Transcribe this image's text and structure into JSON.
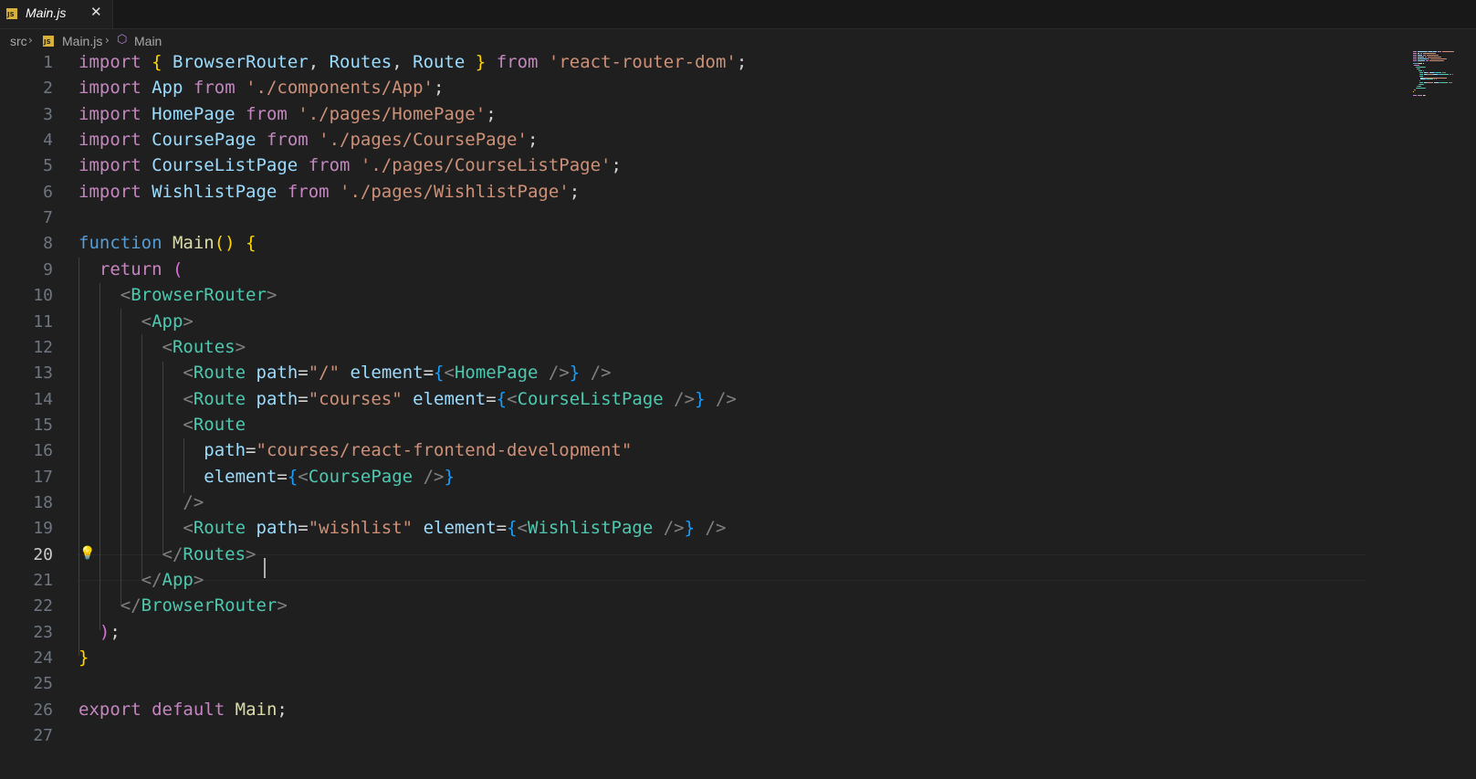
{
  "tab": {
    "filename": "Main.js",
    "badge": "JS",
    "close_glyph": "✕"
  },
  "breadcrumb": {
    "items": [
      "src",
      "Main.js",
      "Main"
    ],
    "separator": "›",
    "badge": "JS"
  },
  "editor": {
    "active_line": 20,
    "line_numbers": [
      "1",
      "2",
      "3",
      "4",
      "5",
      "6",
      "7",
      "8",
      "9",
      "10",
      "11",
      "12",
      "13",
      "14",
      "15",
      "16",
      "17",
      "18",
      "19",
      "20",
      "21",
      "22",
      "23",
      "24",
      "25",
      "26",
      "27"
    ],
    "lines": [
      [
        [
          "k",
          "import"
        ],
        [
          "p",
          " "
        ],
        [
          "b1",
          "{"
        ],
        [
          "p",
          " "
        ],
        [
          "v",
          "BrowserRouter"
        ],
        [
          "p",
          ", "
        ],
        [
          "v",
          "Routes"
        ],
        [
          "p",
          ", "
        ],
        [
          "v",
          "Route"
        ],
        [
          "p",
          " "
        ],
        [
          "b1",
          "}"
        ],
        [
          "p",
          " "
        ],
        [
          "k",
          "from"
        ],
        [
          "p",
          " "
        ],
        [
          "s",
          "'react-router-dom'"
        ],
        [
          "p",
          ";"
        ]
      ],
      [
        [
          "k",
          "import"
        ],
        [
          "p",
          " "
        ],
        [
          "v",
          "App"
        ],
        [
          "p",
          " "
        ],
        [
          "k",
          "from"
        ],
        [
          "p",
          " "
        ],
        [
          "s",
          "'./components/App'"
        ],
        [
          "p",
          ";"
        ]
      ],
      [
        [
          "k",
          "import"
        ],
        [
          "p",
          " "
        ],
        [
          "v",
          "HomePage"
        ],
        [
          "p",
          " "
        ],
        [
          "k",
          "from"
        ],
        [
          "p",
          " "
        ],
        [
          "s",
          "'./pages/HomePage'"
        ],
        [
          "p",
          ";"
        ]
      ],
      [
        [
          "k",
          "import"
        ],
        [
          "p",
          " "
        ],
        [
          "v",
          "CoursePage"
        ],
        [
          "p",
          " "
        ],
        [
          "k",
          "from"
        ],
        [
          "p",
          " "
        ],
        [
          "s",
          "'./pages/CoursePage'"
        ],
        [
          "p",
          ";"
        ]
      ],
      [
        [
          "k",
          "import"
        ],
        [
          "p",
          " "
        ],
        [
          "v",
          "CourseListPage"
        ],
        [
          "p",
          " "
        ],
        [
          "k",
          "from"
        ],
        [
          "p",
          " "
        ],
        [
          "s",
          "'./pages/CourseListPage'"
        ],
        [
          "p",
          ";"
        ]
      ],
      [
        [
          "k",
          "import"
        ],
        [
          "p",
          " "
        ],
        [
          "v",
          "WishlistPage"
        ],
        [
          "p",
          " "
        ],
        [
          "k",
          "from"
        ],
        [
          "p",
          " "
        ],
        [
          "s",
          "'./pages/WishlistPage'"
        ],
        [
          "p",
          ";"
        ]
      ],
      [],
      [
        [
          "kb",
          "function"
        ],
        [
          "p",
          " "
        ],
        [
          "f",
          "Main"
        ],
        [
          "b1",
          "()"
        ],
        [
          "p",
          " "
        ],
        [
          "b1",
          "{"
        ]
      ],
      [
        [
          "p",
          "  "
        ],
        [
          "k",
          "return"
        ],
        [
          "p",
          " "
        ],
        [
          "b2",
          "("
        ]
      ],
      [
        [
          "p",
          "    "
        ],
        [
          "g",
          "<"
        ],
        [
          "t",
          "BrowserRouter"
        ],
        [
          "g",
          ">"
        ]
      ],
      [
        [
          "p",
          "      "
        ],
        [
          "g",
          "<"
        ],
        [
          "t",
          "App"
        ],
        [
          "g",
          ">"
        ]
      ],
      [
        [
          "p",
          "        "
        ],
        [
          "g",
          "<"
        ],
        [
          "t",
          "Routes"
        ],
        [
          "g",
          ">"
        ]
      ],
      [
        [
          "p",
          "          "
        ],
        [
          "g",
          "<"
        ],
        [
          "t",
          "Route"
        ],
        [
          "p",
          " "
        ],
        [
          "v",
          "path"
        ],
        [
          "p",
          "="
        ],
        [
          "s",
          "\"/\""
        ],
        [
          "p",
          " "
        ],
        [
          "v",
          "element"
        ],
        [
          "p",
          "="
        ],
        [
          "b3",
          "{"
        ],
        [
          "g",
          "<"
        ],
        [
          "t",
          "HomePage"
        ],
        [
          "p",
          " "
        ],
        [
          "g",
          "/>"
        ],
        [
          "b3",
          "}"
        ],
        [
          "p",
          " "
        ],
        [
          "g",
          "/>"
        ]
      ],
      [
        [
          "p",
          "          "
        ],
        [
          "g",
          "<"
        ],
        [
          "t",
          "Route"
        ],
        [
          "p",
          " "
        ],
        [
          "v",
          "path"
        ],
        [
          "p",
          "="
        ],
        [
          "s",
          "\"courses\""
        ],
        [
          "p",
          " "
        ],
        [
          "v",
          "element"
        ],
        [
          "p",
          "="
        ],
        [
          "b3",
          "{"
        ],
        [
          "g",
          "<"
        ],
        [
          "t",
          "CourseListPage"
        ],
        [
          "p",
          " "
        ],
        [
          "g",
          "/>"
        ],
        [
          "b3",
          "}"
        ],
        [
          "p",
          " "
        ],
        [
          "g",
          "/>"
        ]
      ],
      [
        [
          "p",
          "          "
        ],
        [
          "g",
          "<"
        ],
        [
          "t",
          "Route"
        ]
      ],
      [
        [
          "p",
          "            "
        ],
        [
          "v",
          "path"
        ],
        [
          "p",
          "="
        ],
        [
          "s",
          "\"courses/react-frontend-development\""
        ]
      ],
      [
        [
          "p",
          "            "
        ],
        [
          "v",
          "element"
        ],
        [
          "p",
          "="
        ],
        [
          "b3",
          "{"
        ],
        [
          "g",
          "<"
        ],
        [
          "t",
          "CoursePage"
        ],
        [
          "p",
          " "
        ],
        [
          "g",
          "/>"
        ],
        [
          "b3",
          "}"
        ]
      ],
      [
        [
          "p",
          "          "
        ],
        [
          "g",
          "/>"
        ]
      ],
      [
        [
          "p",
          "          "
        ],
        [
          "g",
          "<"
        ],
        [
          "t",
          "Route"
        ],
        [
          "p",
          " "
        ],
        [
          "v",
          "path"
        ],
        [
          "p",
          "="
        ],
        [
          "s",
          "\"wishlist\""
        ],
        [
          "p",
          " "
        ],
        [
          "v",
          "element"
        ],
        [
          "p",
          "="
        ],
        [
          "b3",
          "{"
        ],
        [
          "g",
          "<"
        ],
        [
          "t",
          "WishlistPage"
        ],
        [
          "p",
          " "
        ],
        [
          "g",
          "/>"
        ],
        [
          "b3",
          "}"
        ],
        [
          "p",
          " "
        ],
        [
          "g",
          "/>"
        ]
      ],
      [
        [
          "p",
          "        "
        ],
        [
          "g",
          "</"
        ],
        [
          "t",
          "Routes"
        ],
        [
          "g",
          ">"
        ]
      ],
      [
        [
          "p",
          "      "
        ],
        [
          "g",
          "</"
        ],
        [
          "t",
          "App"
        ],
        [
          "g",
          ">"
        ]
      ],
      [
        [
          "p",
          "    "
        ],
        [
          "g",
          "</"
        ],
        [
          "t",
          "BrowserRouter"
        ],
        [
          "g",
          ">"
        ]
      ],
      [
        [
          "p",
          "  "
        ],
        [
          "b2",
          ")"
        ],
        [
          "p",
          ";"
        ]
      ],
      [
        [
          "b1",
          "}"
        ]
      ],
      [],
      [
        [
          "k",
          "export"
        ],
        [
          "p",
          " "
        ],
        [
          "k",
          "default"
        ],
        [
          "p",
          " "
        ],
        [
          "f",
          "Main"
        ],
        [
          "p",
          ";"
        ]
      ],
      []
    ]
  },
  "colors": {
    "background": "#1f1f1f",
    "keyword": "#c586c0",
    "storage": "#569cd6",
    "variable": "#9cdcfe",
    "string": "#ce9178",
    "function": "#dcdcaa",
    "tag": "#4ec9b0"
  }
}
